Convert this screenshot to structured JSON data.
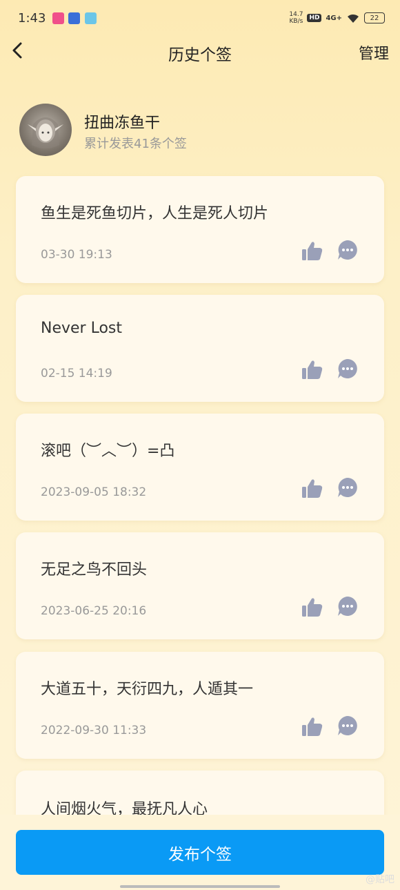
{
  "status_bar": {
    "time": "1:43",
    "speed_value": "14.7",
    "speed_unit": "KB/s",
    "hd": "HD",
    "network": "4G+",
    "battery": "22"
  },
  "nav": {
    "title": "历史个签",
    "manage_label": "管理"
  },
  "profile": {
    "name": "扭曲冻鱼干",
    "count_text": "累计发表41条个签"
  },
  "posts": [
    {
      "text": "鱼生是死鱼切片，人生是死人切片",
      "time": "03-30 19:13"
    },
    {
      "text": "Never Lost",
      "time": "02-15 14:19"
    },
    {
      "text": "滚吧（︶︿︶）=凸",
      "time": "2023-09-05 18:32"
    },
    {
      "text": "无足之鸟不回头",
      "time": "2023-06-25 20:16"
    },
    {
      "text": "大道五十，天衍四九，人遁其一",
      "time": "2022-09-30 11:33"
    },
    {
      "text": "人间烟火气，最抚凡人心",
      "time": ""
    }
  ],
  "publish_label": "发布个签",
  "watermark": "@贴吧",
  "colors": {
    "accent": "#0a9af5",
    "icon": "#9aa0b8",
    "card_bg": "#fff9ec"
  }
}
